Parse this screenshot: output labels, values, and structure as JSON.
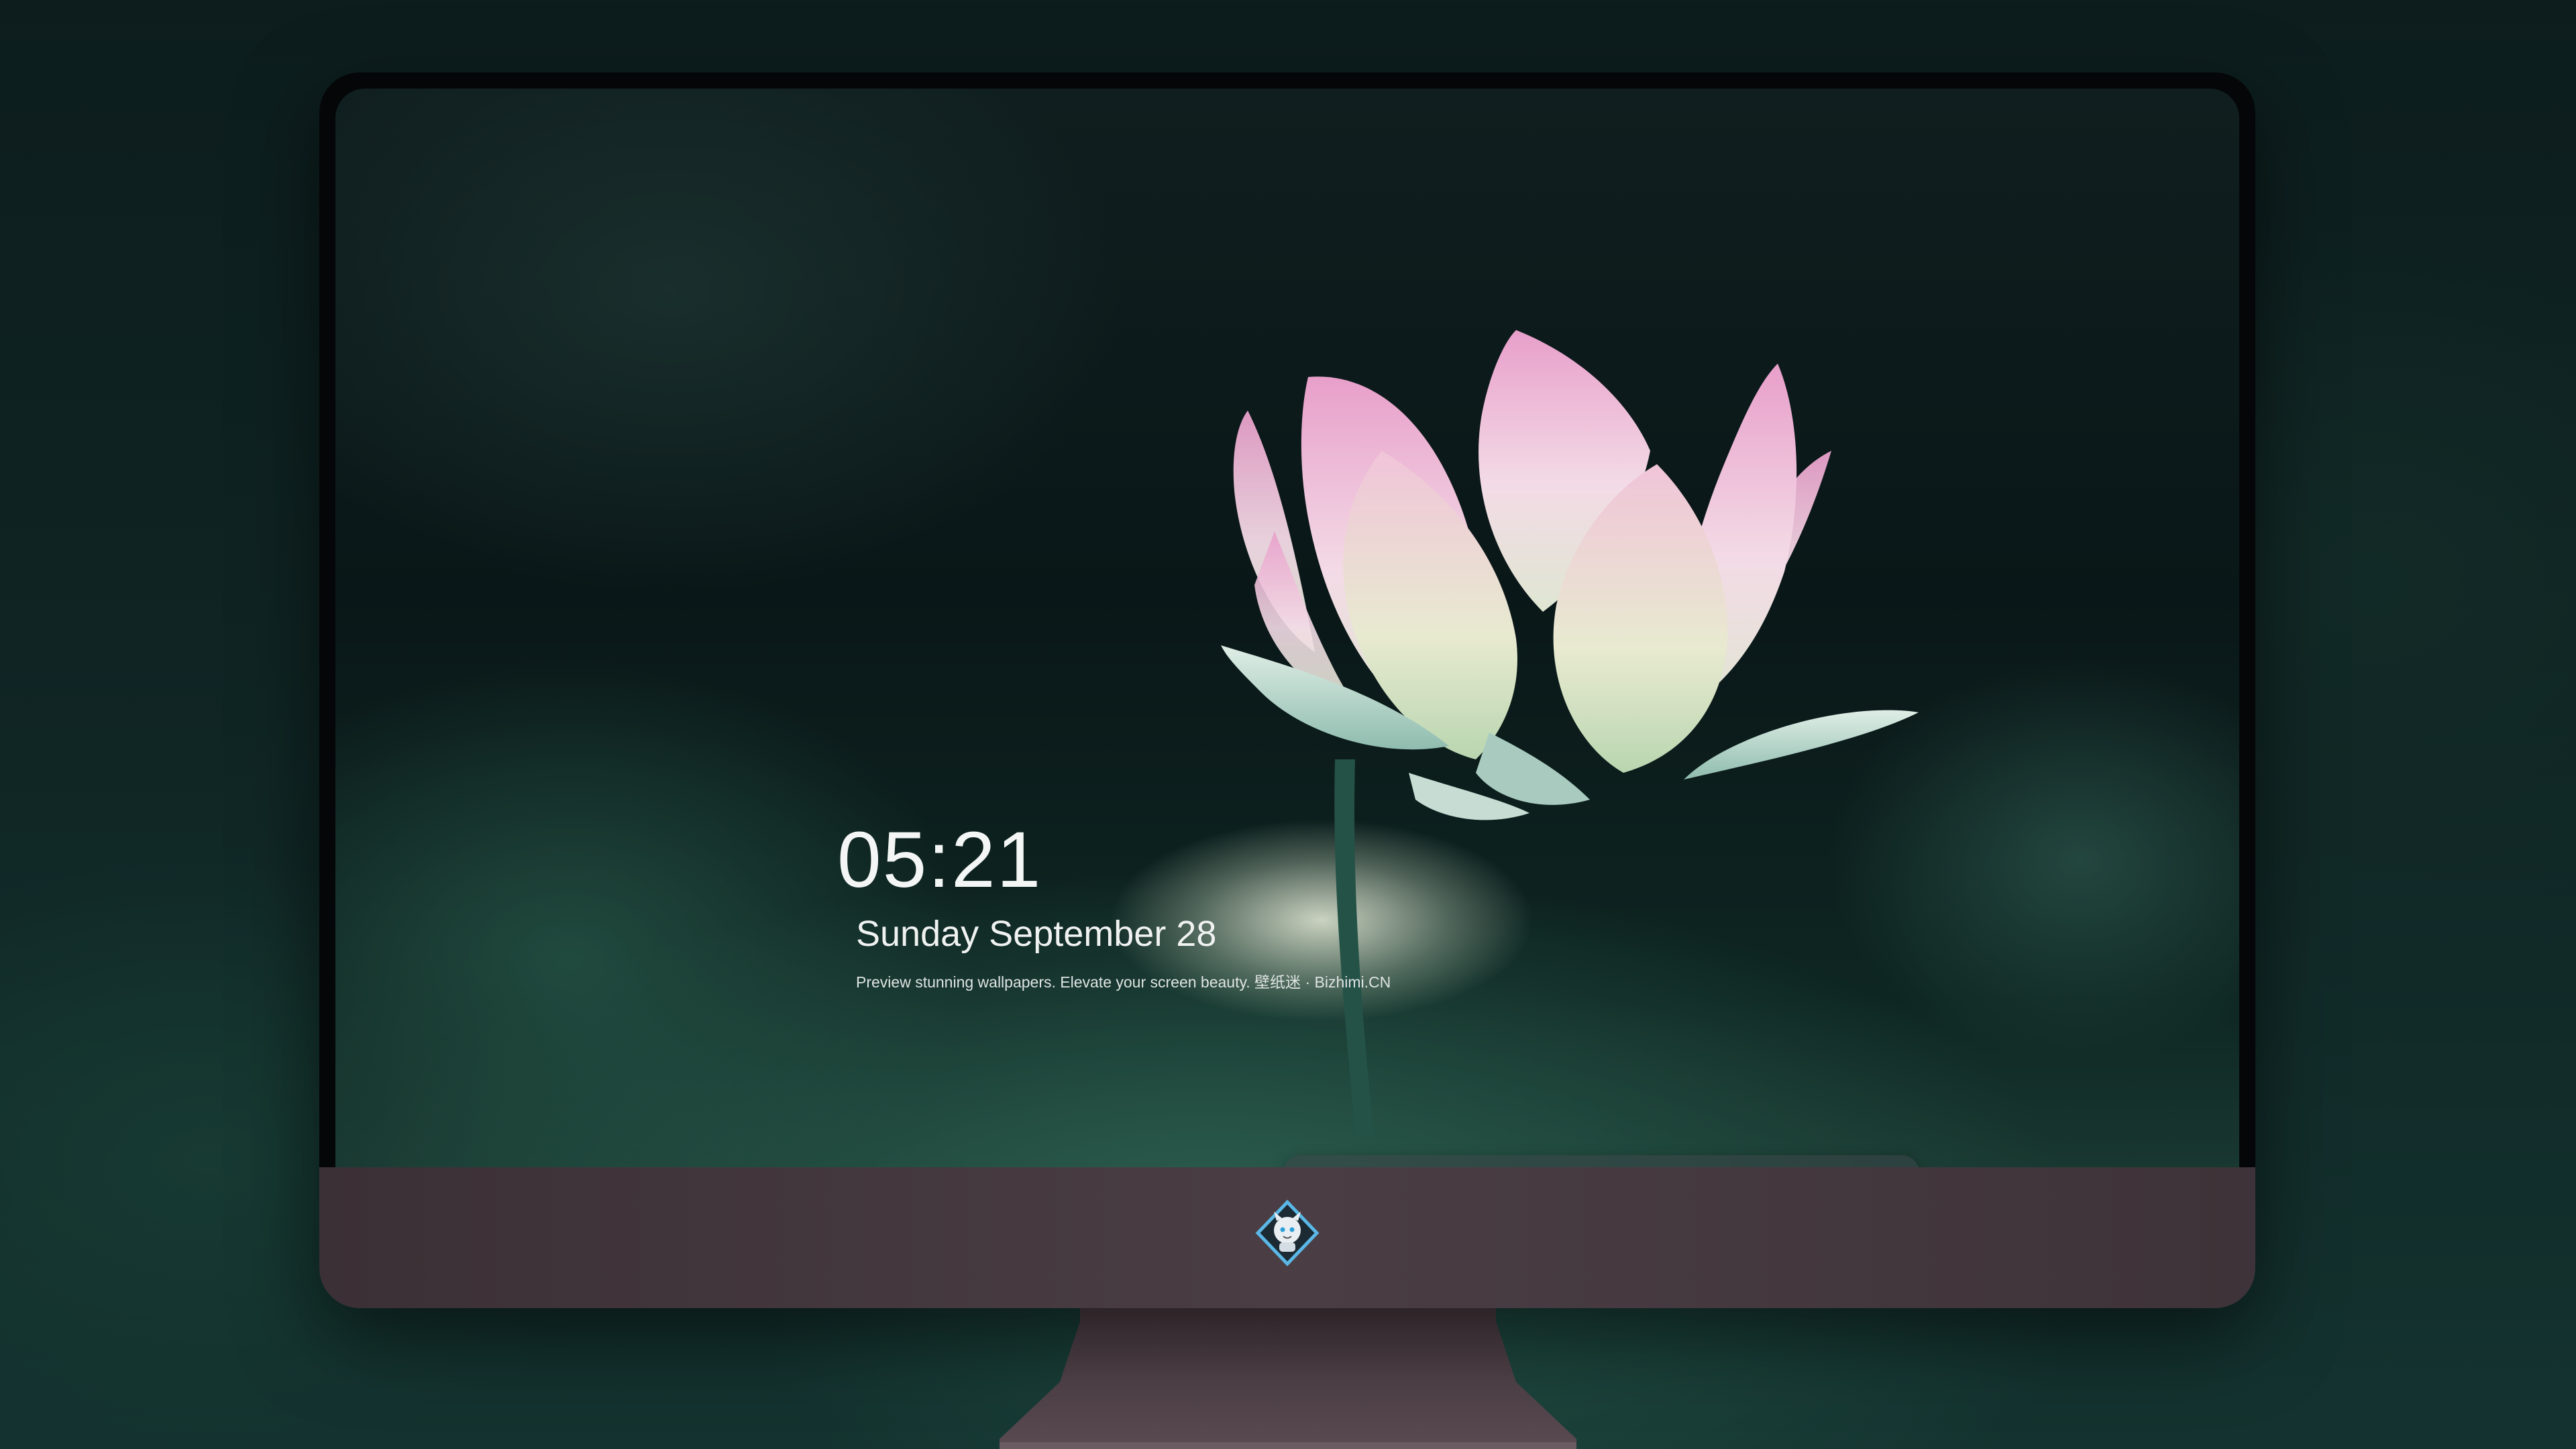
{
  "lockscreen": {
    "time": "05:21",
    "date": "Sunday September  28",
    "tagline": "Preview stunning wallpapers. Elevate your screen beauty. 壁纸迷 · Bizhimi.CN"
  },
  "dock": {
    "apps": [
      {
        "icon": "messages-icon",
        "color": "#2fcd4b"
      },
      {
        "icon": "weather-icon",
        "color": "#2e8cf0"
      },
      {
        "icon": "clock-icon",
        "color": "#1a1a1a"
      },
      {
        "icon": "preview-icon",
        "color": "#f2c94c"
      },
      {
        "icon": "clips-icon",
        "color": "#49c9e8"
      },
      {
        "icon": "notes-icon",
        "color": "#f7d44c"
      },
      {
        "icon": "photo-booth-icon",
        "color": "#e85c3a"
      },
      {
        "icon": "itunes-icon",
        "color": "#d94cf0"
      },
      {
        "icon": "app-store-icon",
        "color": "#2c8cf5"
      },
      {
        "icon": "camera-icon",
        "color": "#9aa0a4"
      }
    ]
  }
}
